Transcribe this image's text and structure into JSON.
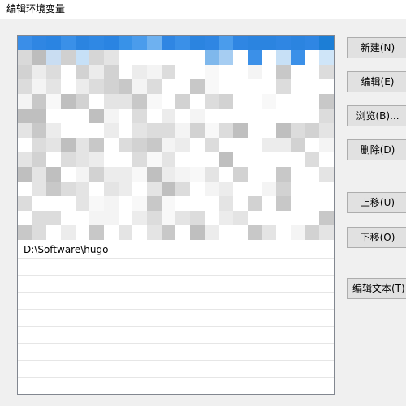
{
  "window": {
    "title": "编辑环境变量"
  },
  "list": {
    "entries": [
      "D:\\Software\\hugo"
    ]
  },
  "buttons": {
    "new": "新建(N)",
    "edit": "编辑(E)",
    "browse": "浏览(B)...",
    "delete": "删除(D)",
    "move_up": "上移(U)",
    "move_down": "下移(O)",
    "edit_text": "编辑文本(T)..."
  },
  "colors": {
    "selection": "#1c7ed6",
    "pixelation_light": "#f0f0f0",
    "pixelation_mid": "#cfcfcf",
    "pixelation_dark": "#a9a9a9"
  }
}
